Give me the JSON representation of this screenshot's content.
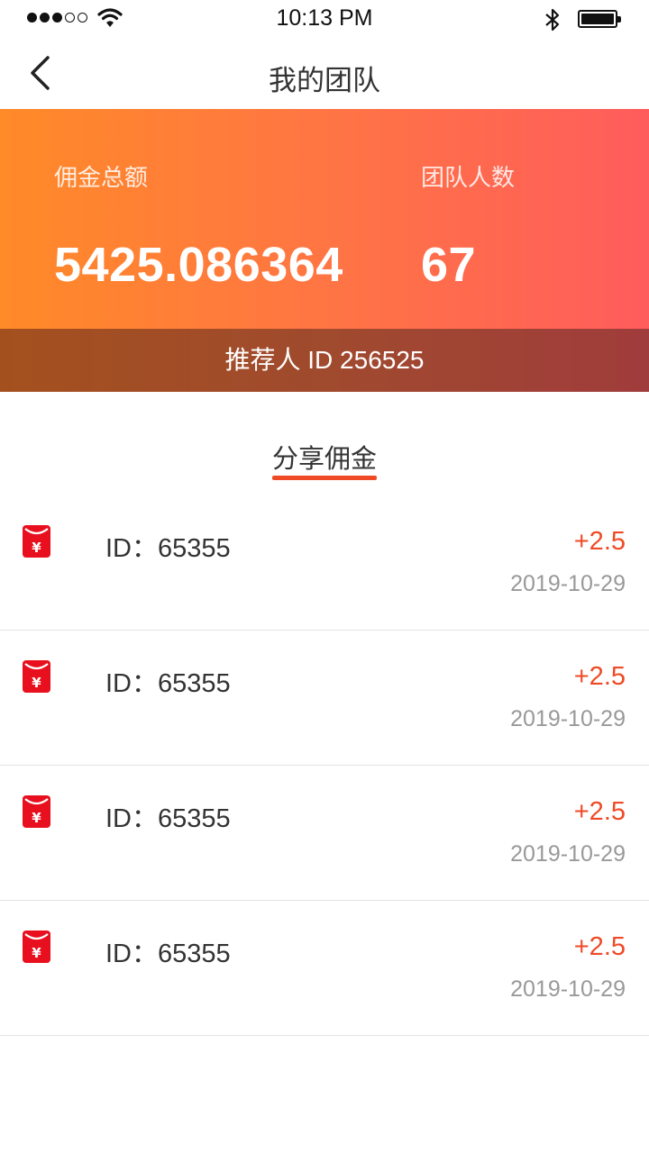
{
  "status_bar": {
    "time": "10:13 PM",
    "signal_icon": "signal-dots-icon",
    "wifi_icon": "wifi-icon",
    "bluetooth_icon": "bluetooth-icon",
    "battery_icon": "battery-icon"
  },
  "nav": {
    "title": "我的团队",
    "back_icon": "chevron-left-icon"
  },
  "summary": {
    "commission_label": "佣金总额",
    "commission_value": "5425.086364",
    "team_label": "团队人数",
    "team_value": "67",
    "referrer_text": "推荐人 ID 256525"
  },
  "tab": {
    "label": "分享佣金",
    "accent_color": "#ef4a25"
  },
  "records": [
    {
      "icon": "red-envelope-icon",
      "id_text": "ID：65355",
      "amount": "+2.5",
      "date": "2019-10-29"
    },
    {
      "icon": "red-envelope-icon",
      "id_text": "ID：65355",
      "amount": "+2.5",
      "date": "2019-10-29"
    },
    {
      "icon": "red-envelope-icon",
      "id_text": "ID：65355",
      "amount": "+2.5",
      "date": "2019-10-29"
    },
    {
      "icon": "red-envelope-icon",
      "id_text": "ID：65355",
      "amount": "+2.5",
      "date": "2019-10-29"
    }
  ],
  "colors": {
    "banner_start": "#ff8a28",
    "banner_end": "#ff5c5c",
    "amount": "#ef4a25",
    "date": "#999999"
  }
}
